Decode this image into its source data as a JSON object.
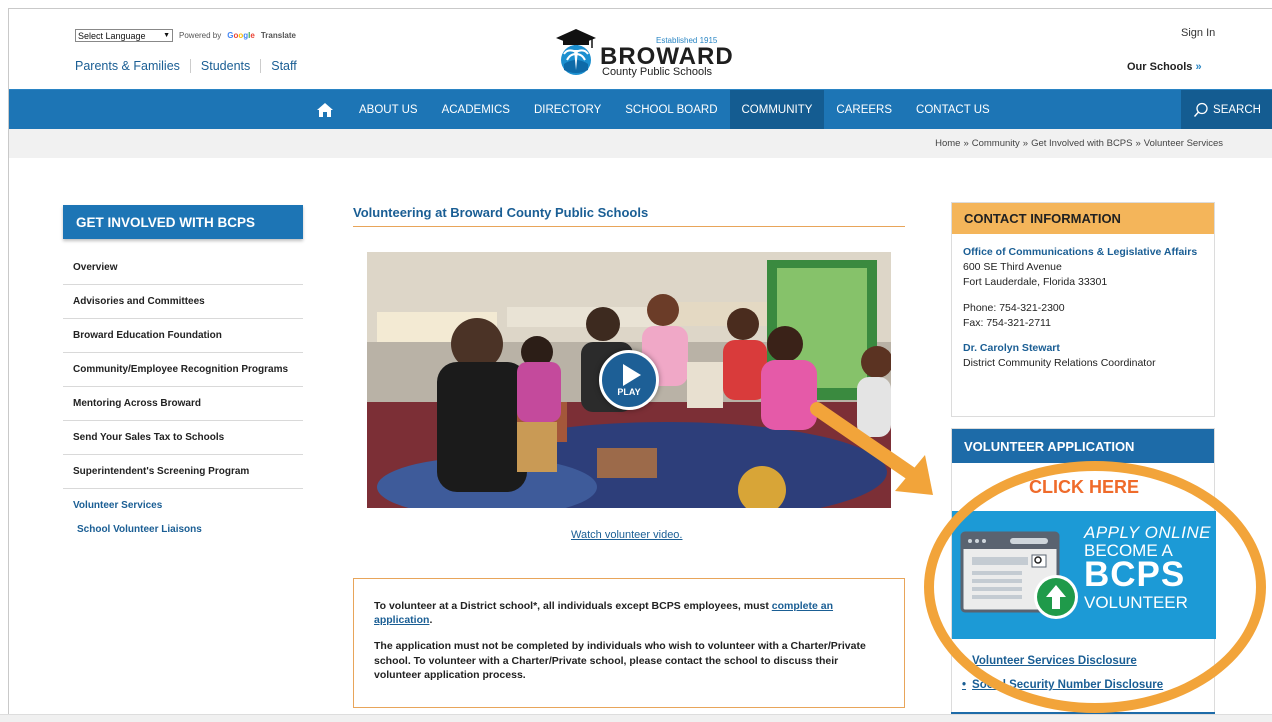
{
  "header": {
    "language_select": "Select Language",
    "powered_by": "Powered by",
    "google": [
      "G",
      "o",
      "o",
      "g",
      "l",
      "e"
    ],
    "translate": "Translate",
    "audience_links": [
      "Parents & Families",
      "Students",
      "Staff"
    ],
    "logo_established": "Established 1915",
    "logo_name": "BROWARD",
    "logo_subtitle": "County Public Schools",
    "sign_in": "Sign In",
    "our_schools": "Our Schools",
    "our_schools_chevron": "»"
  },
  "nav": {
    "home_icon": "home-icon",
    "items": [
      "ABOUT US",
      "ACADEMICS",
      "DIRECTORY",
      "SCHOOL BOARD",
      "COMMUNITY",
      "CAREERS",
      "CONTACT US"
    ],
    "active": "COMMUNITY",
    "search_label": "SEARCH",
    "accent_color": "#1d75b5"
  },
  "breadcrumb": {
    "items": [
      "Home",
      "Community",
      "Get Involved with BCPS",
      "Volunteer Services"
    ],
    "separator": "»"
  },
  "sidebar": {
    "title": "GET INVOLVED WITH BCPS",
    "items": [
      "Overview",
      "Advisories and Committees",
      "Broward Education Foundation",
      "Community/Employee Recognition Programs",
      "Mentoring Across Broward",
      "Send Your Sales Tax to Schools",
      "Superintendent's Screening Program",
      "Volunteer Services"
    ],
    "current": "Volunteer Services",
    "sub_items": [
      "School Volunteer Liaisons"
    ]
  },
  "main": {
    "title": "Volunteering at Broward County Public Schools",
    "play_label": "PLAY",
    "watch_link": "Watch volunteer video.",
    "notice": {
      "p1_text": "To volunteer at a District school*, all individuals except BCPS employees, must ",
      "p1_link": "complete an application",
      "p1_end": ".",
      "p2": "The application must not be completed by individuals who wish to volunteer with a Charter/Private school. To volunteer with a Charter/Private school, please contact the school to discuss their volunteer application process."
    }
  },
  "contact": {
    "title": "CONTACT INFORMATION",
    "org": "Office of Communications & Legislative Affairs",
    "address1": "600 SE Third Avenue",
    "address2": "Fort Lauderdale, Florida 33301",
    "phone": "Phone: 754-321-2300",
    "fax": "Fax: 754-321-2711",
    "person": "Dr. Carolyn Stewart",
    "person_title": "District Community Relations Coordinator"
  },
  "volunteer": {
    "title": "VOLUNTEER APPLICATION",
    "click_here": "CLICK HERE",
    "banner_line1": "APPLY ONLINE",
    "banner_line2": "BECOME A",
    "banner_line3": "BCPS",
    "banner_line4": "VOLUNTEER",
    "links": [
      "Volunteer Services Disclosure",
      "Social Security Number Disclosure"
    ]
  },
  "colors": {
    "brand_blue": "#1d75b5",
    "orange_callout": "#f2a43a",
    "contact_header": "#f4b55a",
    "click_here": "#ef6b2b"
  }
}
